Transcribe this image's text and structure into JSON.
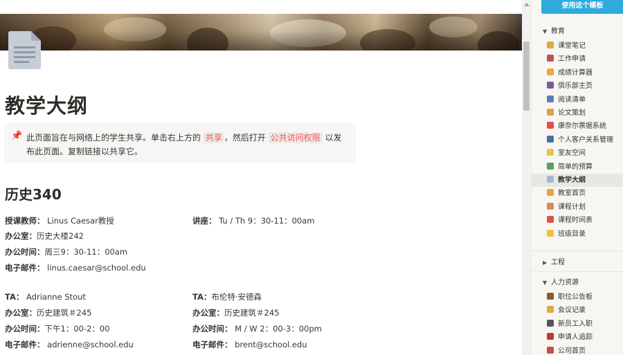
{
  "doc": {
    "title": "教学大纲",
    "callout": {
      "icon": "pushpin-icon",
      "part1": "此页面旨在与网络上的学生共享。单击右上方的",
      "code1": "共享",
      "part2": "，然后打开",
      "code2": "公共访问权限",
      "part3": "以发布此页面。复制链接以共享它。"
    },
    "course": "历史340",
    "info": {
      "instructor_label": "授课教师：",
      "instructor": "Linus Caesar教授",
      "lecture_label": "讲座：",
      "lecture": "Tu / Th 9：30-11：00am",
      "office_label": "办公室：",
      "office": "历史大楼242",
      "hours_label": "办公时间：",
      "hours": "周三9：30-11：00am",
      "email_label": "电子邮件：",
      "email": "linus.caesar@school.edu"
    },
    "ta1": {
      "label": "TA：",
      "name": "Adrianne Stout",
      "office_label": "办公室：",
      "office": "历史建筑＃245",
      "hours_label": "办公时间：",
      "hours": "下午1：00-2：00",
      "email_label": "电子邮件：",
      "email": "adrienne@school.edu"
    },
    "ta2": {
      "label": "TA：",
      "name": "布伦特·安德森",
      "office_label": "办公室：",
      "office": "历史建筑＃245",
      "hours_label": "办公时间：",
      "hours": "M / W 2：00-3：00pm",
      "email_label": "电子邮件：",
      "email": "brent@school.edu"
    }
  },
  "sidebar": {
    "use_button": "使用这个模板",
    "groups": [
      {
        "label": "教育",
        "expanded": true
      },
      {
        "label": "工程",
        "expanded": false
      },
      {
        "label": "人力资源",
        "expanded": true
      }
    ],
    "education_items": [
      {
        "label": "课堂笔记",
        "icon": "pencil-icon",
        "color": "#e0a93b"
      },
      {
        "label": "工作申请",
        "icon": "runner-icon",
        "color": "#c0504d"
      },
      {
        "label": "成绩计算器",
        "icon": "calculator-icon",
        "color": "#e7a64a"
      },
      {
        "label": "俱乐部主页",
        "icon": "calendar-icon",
        "color": "#7d5a9e"
      },
      {
        "label": "阅读清单",
        "icon": "books-icon",
        "color": "#5b7db1"
      },
      {
        "label": "论文策划",
        "icon": "scroll-icon",
        "color": "#d9a441"
      },
      {
        "label": "康奈尔票据系统",
        "icon": "pin-icon",
        "color": "#d9534f"
      },
      {
        "label": "个人客户关系管理",
        "icon": "people-icon",
        "color": "#4a6fa5"
      },
      {
        "label": "室友空间",
        "icon": "bulb-icon",
        "color": "#f0c33c"
      },
      {
        "label": "简单的预算",
        "icon": "money-icon",
        "color": "#5aa05a"
      },
      {
        "label": "教学大纲",
        "icon": "document-icon",
        "color": "#a9b7c6",
        "active": true
      },
      {
        "label": "教室首页",
        "icon": "school-icon",
        "color": "#e0a93b"
      },
      {
        "label": "课程计划",
        "icon": "clipboard-icon",
        "color": "#d98c5f"
      },
      {
        "label": "课程时间表",
        "icon": "calendar-icon",
        "color": "#d9534f"
      },
      {
        "label": "班级目录",
        "icon": "pencil-icon",
        "color": "#f0c33c"
      }
    ],
    "hr_items": [
      {
        "label": "职位公告板",
        "icon": "briefcase-icon",
        "color": "#8b5a2b"
      },
      {
        "label": "会议记录",
        "icon": "pencil-icon",
        "color": "#e0a93b"
      },
      {
        "label": "新员工入职",
        "icon": "people-icon",
        "color": "#555555"
      },
      {
        "label": "申请人追踪",
        "icon": "shield-icon",
        "color": "#c0392b"
      },
      {
        "label": "公司首页",
        "icon": "house-icon",
        "color": "#c0504d"
      }
    ]
  }
}
